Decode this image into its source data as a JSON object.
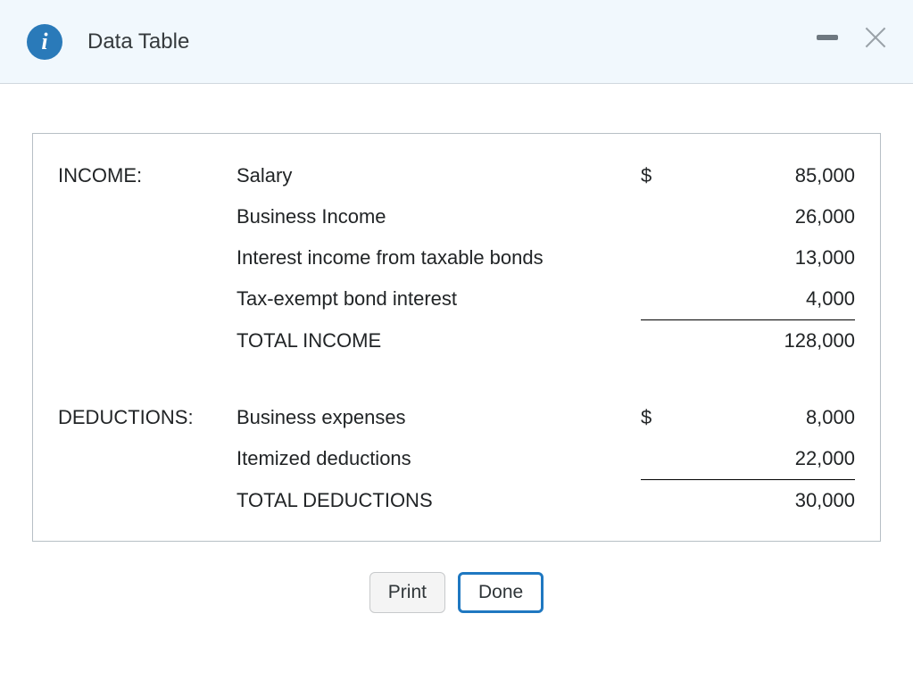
{
  "header": {
    "title": "Data Table"
  },
  "sections": {
    "income": {
      "heading": "INCOME:",
      "rows": {
        "salary": {
          "label": "Salary",
          "currency": "$",
          "value": "85,000"
        },
        "business": {
          "label": "Business Income",
          "value": "26,000"
        },
        "interest": {
          "label": "Interest income from taxable bonds",
          "value": "13,000"
        },
        "taxexempt": {
          "label": "Tax-exempt bond interest",
          "value": "4,000"
        },
        "total": {
          "label": "TOTAL INCOME",
          "value": "128,000"
        }
      }
    },
    "deductions": {
      "heading": "DEDUCTIONS:",
      "rows": {
        "expenses": {
          "label": "Business expenses",
          "currency": "$",
          "value": "8,000"
        },
        "itemized": {
          "label": "Itemized deductions",
          "value": "22,000"
        },
        "total": {
          "label": "TOTAL DEDUCTIONS",
          "value": "30,000"
        }
      }
    }
  },
  "buttons": {
    "print": "Print",
    "done": "Done"
  }
}
